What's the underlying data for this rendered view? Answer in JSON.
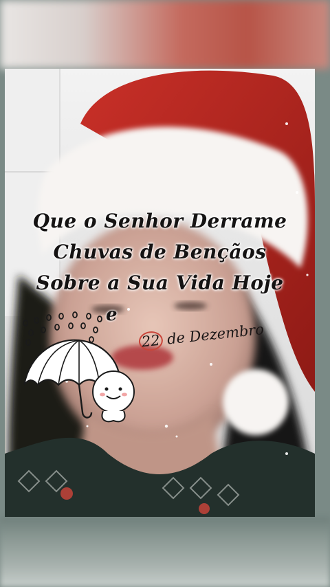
{
  "caption": {
    "line1": "Que o Senhor Derrame",
    "line2": "Chuvas de Bençãos",
    "line3": "Sobre a Sua Vida Hoje",
    "conjunction": "e"
  },
  "date_label": {
    "number": "22",
    "text": "de Dezembro"
  },
  "colors": {
    "hat_red": "#b3241d",
    "fur_white": "#f7f4f2",
    "text": "#151313",
    "date_circle": "#c9453a"
  },
  "sticker": {
    "icon": "umbrella-rain-smiley-icon"
  }
}
